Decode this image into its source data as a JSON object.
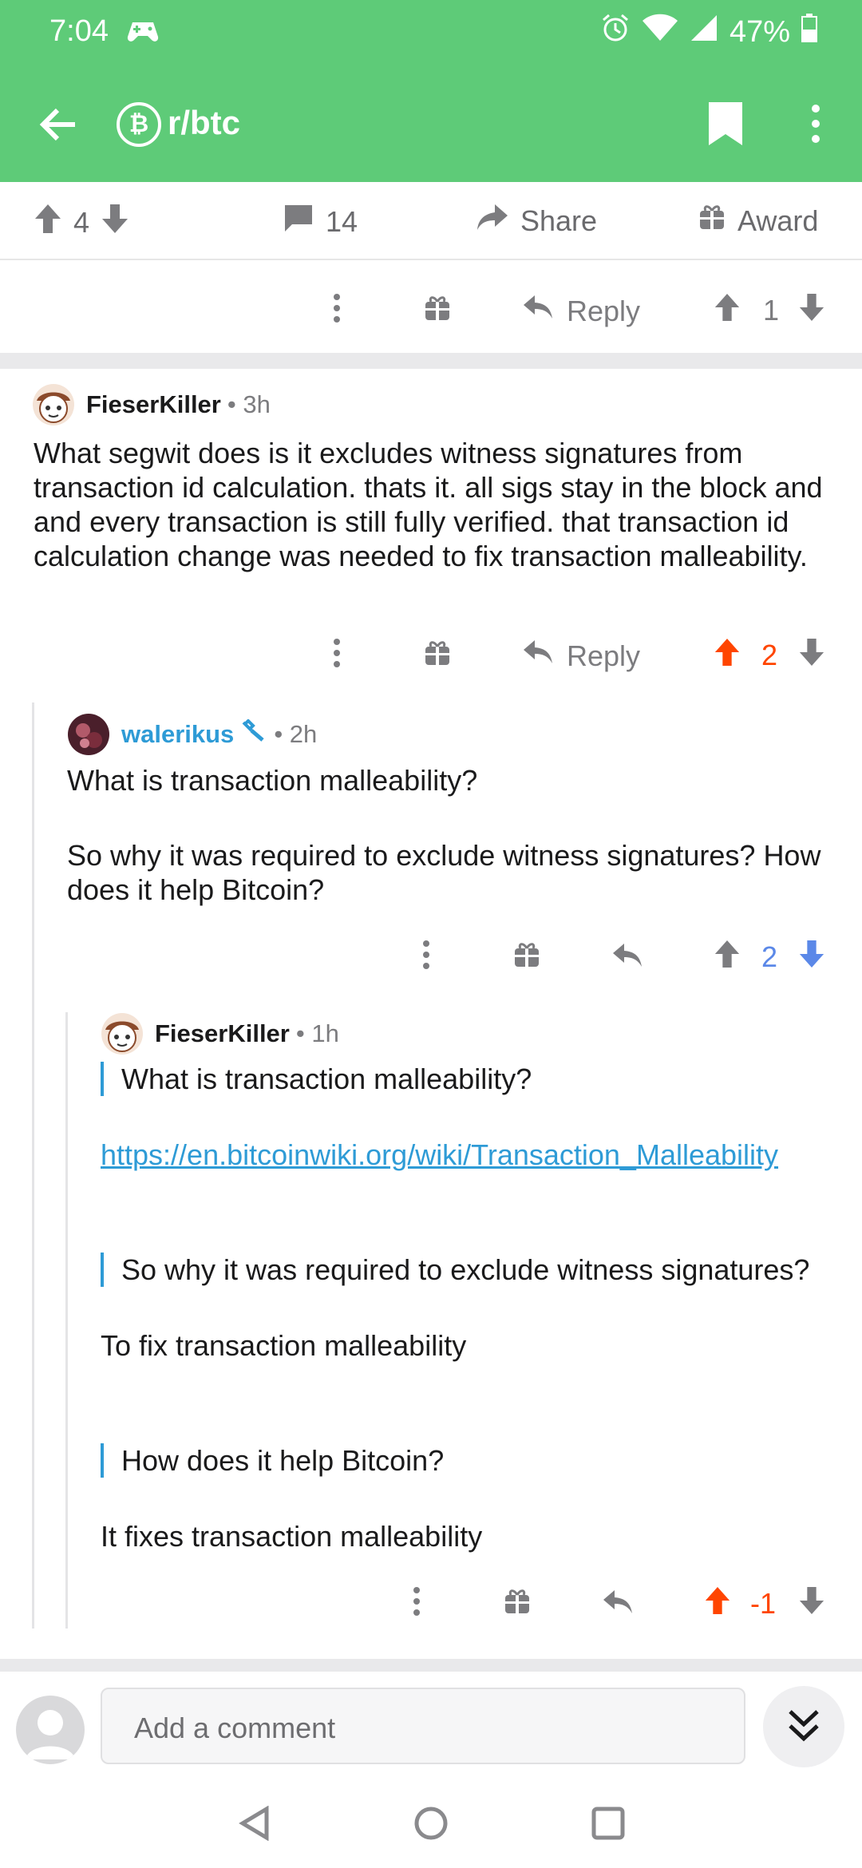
{
  "status_bar": {
    "time": "7:04",
    "battery": "47%"
  },
  "app_bar": {
    "subreddit": "r/btc",
    "sub_icon": "bitcoin-icon"
  },
  "post_actions": {
    "votes": "4",
    "comments": "14",
    "share": "Share",
    "award": "Award"
  },
  "prev_comment": {
    "reply": "Reply",
    "votes": "1"
  },
  "comments": [
    {
      "author": "FieserKiller",
      "age": "3h",
      "body": "What segwit does is it excludes witness signatures from transaction id calculation. thats it. all sigs stay in the block and and every transaction is still fully verified. that transaction id calculation change was needed to fix transaction malleability.",
      "reply": "Reply",
      "votes": "2",
      "vote_state": "up"
    },
    {
      "author": "walerikus",
      "age": "2h",
      "body_1": "What is transaction malleability?",
      "body_2": "So why it was required to exclude witness signatures? How does it help Bitcoin?",
      "votes": "2",
      "vote_state": "down"
    },
    {
      "author": "FieserKiller",
      "age": "1h",
      "quote_1": "What is transaction malleability?",
      "link": "https://en.bitcoinwiki.org/wiki/Transaction_Malleability",
      "quote_2": "So why it was required to exclude witness signatures?",
      "text_2": "To fix transaction malleability",
      "quote_3": "How does it help Bitcoin?",
      "text_3": "It fixes transaction malleability",
      "votes": "-1",
      "vote_state": "up"
    }
  ],
  "composer": {
    "placeholder": "Add a comment"
  },
  "colors": {
    "header": "#5ecb78",
    "upvote": "#ff4500",
    "downvote": "#5b88e8",
    "link": "#2e9bd6"
  }
}
